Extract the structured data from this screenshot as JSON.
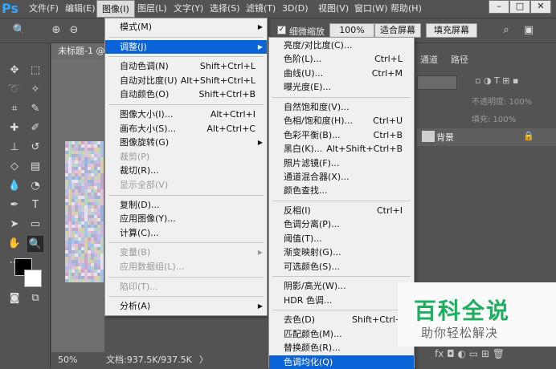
{
  "app": {
    "logo": "Ps"
  },
  "menubar": {
    "items": [
      "文件(F)",
      "编辑(E)",
      "图像(I)",
      "图层(L)",
      "文字(Y)",
      "选择(S)",
      "滤镜(T)",
      "3D(D)",
      "视图(V)",
      "窗口(W)",
      "帮助(H)"
    ],
    "active_index": 2,
    "window_buttons": [
      "–",
      "□",
      "✕"
    ]
  },
  "optionsbar": {
    "fine_zoom_label": "细微缩放",
    "zoom_value": "100%",
    "fit_screen": "适合屏幕",
    "fill_screen": "填充屏幕"
  },
  "document": {
    "tab_title": "未标题-1 @",
    "status_zoom": "50%",
    "status_doc": "文档:937.5K/937.5K",
    "status_arrow": "〉"
  },
  "panel": {
    "tabs": [
      "通道",
      "路径"
    ],
    "kind_placeholder": "",
    "opacity_label": "不透明度: 100%",
    "fill_label": "填充: 100%",
    "layer_name": "背景"
  },
  "image_menu": {
    "items": [
      {
        "label": "模式(M)",
        "shortcut": "",
        "arrow": true,
        "state": "normal"
      },
      {
        "sep": true
      },
      {
        "label": "调整(J)",
        "shortcut": "",
        "arrow": true,
        "state": "highlight"
      },
      {
        "sep": true
      },
      {
        "label": "自动色调(N)",
        "shortcut": "Shift+Ctrl+L",
        "state": "normal"
      },
      {
        "label": "自动对比度(U)",
        "shortcut": "Alt+Shift+Ctrl+L",
        "state": "normal"
      },
      {
        "label": "自动颜色(O)",
        "shortcut": "Shift+Ctrl+B",
        "state": "normal"
      },
      {
        "sep": true
      },
      {
        "label": "图像大小(I)...",
        "shortcut": "Alt+Ctrl+I",
        "state": "normal"
      },
      {
        "label": "画布大小(S)...",
        "shortcut": "Alt+Ctrl+C",
        "state": "normal"
      },
      {
        "label": "图像旋转(G)",
        "shortcut": "",
        "arrow": true,
        "state": "normal"
      },
      {
        "label": "裁剪(P)",
        "shortcut": "",
        "state": "disabled"
      },
      {
        "label": "裁切(R)...",
        "shortcut": "",
        "state": "normal"
      },
      {
        "label": "显示全部(V)",
        "shortcut": "",
        "state": "disabled"
      },
      {
        "sep": true
      },
      {
        "label": "复制(D)...",
        "shortcut": "",
        "state": "normal"
      },
      {
        "label": "应用图像(Y)...",
        "shortcut": "",
        "state": "normal"
      },
      {
        "label": "计算(C)...",
        "shortcut": "",
        "state": "normal"
      },
      {
        "sep": true
      },
      {
        "label": "变量(B)",
        "shortcut": "",
        "arrow": true,
        "state": "disabled"
      },
      {
        "label": "应用数据组(L)...",
        "shortcut": "",
        "state": "disabled"
      },
      {
        "sep": true
      },
      {
        "label": "陷印(T)...",
        "shortcut": "",
        "state": "disabled"
      },
      {
        "sep": true
      },
      {
        "label": "分析(A)",
        "shortcut": "",
        "arrow": true,
        "state": "normal"
      }
    ]
  },
  "adjust_menu": {
    "items": [
      {
        "label": "亮度/对比度(C)...",
        "shortcut": "",
        "state": "normal"
      },
      {
        "label": "色阶(L)...",
        "shortcut": "Ctrl+L",
        "state": "normal"
      },
      {
        "label": "曲线(U)...",
        "shortcut": "Ctrl+M",
        "state": "normal"
      },
      {
        "label": "曝光度(E)...",
        "shortcut": "",
        "state": "normal"
      },
      {
        "sep": true
      },
      {
        "label": "自然饱和度(V)...",
        "shortcut": "",
        "state": "normal"
      },
      {
        "label": "色相/饱和度(H)...",
        "shortcut": "Ctrl+U",
        "state": "normal"
      },
      {
        "label": "色彩平衡(B)...",
        "shortcut": "Ctrl+B",
        "state": "normal"
      },
      {
        "label": "黑白(K)...",
        "shortcut": "Alt+Shift+Ctrl+B",
        "state": "normal"
      },
      {
        "label": "照片滤镜(F)...",
        "shortcut": "",
        "state": "normal"
      },
      {
        "label": "通道混合器(X)...",
        "shortcut": "",
        "state": "normal"
      },
      {
        "label": "颜色查找...",
        "shortcut": "",
        "state": "normal"
      },
      {
        "sep": true
      },
      {
        "label": "反相(I)",
        "shortcut": "Ctrl+I",
        "state": "normal"
      },
      {
        "label": "色调分离(P)...",
        "shortcut": "",
        "state": "normal"
      },
      {
        "label": "阈值(T)...",
        "shortcut": "",
        "state": "normal"
      },
      {
        "label": "渐变映射(G)...",
        "shortcut": "",
        "state": "normal"
      },
      {
        "label": "可选颜色(S)...",
        "shortcut": "",
        "state": "normal"
      },
      {
        "sep": true
      },
      {
        "label": "阴影/高光(W)...",
        "shortcut": "",
        "state": "normal"
      },
      {
        "label": "HDR 色调...",
        "shortcut": "",
        "state": "normal"
      },
      {
        "sep": true
      },
      {
        "label": "去色(D)",
        "shortcut": "Shift+Ctrl+",
        "state": "normal"
      },
      {
        "label": "匹配颜色(M)...",
        "shortcut": "",
        "state": "normal"
      },
      {
        "label": "替换颜色(R)...",
        "shortcut": "",
        "state": "normal"
      },
      {
        "label": "色调均化(Q)",
        "shortcut": "",
        "state": "highlight"
      }
    ]
  },
  "watermark": {
    "title": "百科全说",
    "subtitle": "助你轻松解决"
  },
  "colors": {
    "highlight": "#0a64d8",
    "watermark_green": "#1eae5f"
  }
}
